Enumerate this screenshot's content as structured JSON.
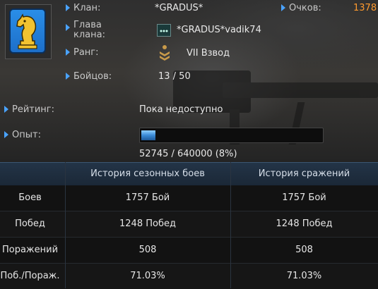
{
  "profile": {
    "clan_label": "Клан:",
    "clan_name": "*GRADUS*",
    "points_label": "Очков:",
    "points_value": "1378",
    "leader_label_line1": "Глава",
    "leader_label_line2": "клана:",
    "leader_name": "*GRADUS*vadik74",
    "rank_label": "Ранг:",
    "rank_value": "VII Взвод",
    "fighters_label": "Бойцов:",
    "fighters_value": "13 / 50",
    "rating_label": "Рейтинг:",
    "rating_value": "Пока недоступно",
    "xp_label": "Опыт:",
    "xp_text": "52745 / 640000 (8%)",
    "xp_fraction": 0.08
  },
  "table": {
    "headers": [
      "",
      "История сезонных боев",
      "История сражений"
    ],
    "rows": [
      {
        "label": "Боев",
        "season": "1757  Бой",
        "total": "1757  Бой"
      },
      {
        "label": "Побед",
        "season": "1248 Побед",
        "total": "1248 Побед"
      },
      {
        "label": "Поражений",
        "season": "508",
        "total": "508"
      },
      {
        "label": "Поб./Пораж.",
        "season": "71.03%",
        "total": "71.03%"
      }
    ]
  },
  "colors": {
    "accent_arrow": "#4aa3ff",
    "points": "#ff9a2e",
    "emblem_blue": "#2a8ee8",
    "emblem_knight": "#f2c230"
  },
  "icons": {
    "emblem": "chess-knight-icon",
    "leader": "clan-leader-icon",
    "rank": "rank-chevron-icon"
  }
}
